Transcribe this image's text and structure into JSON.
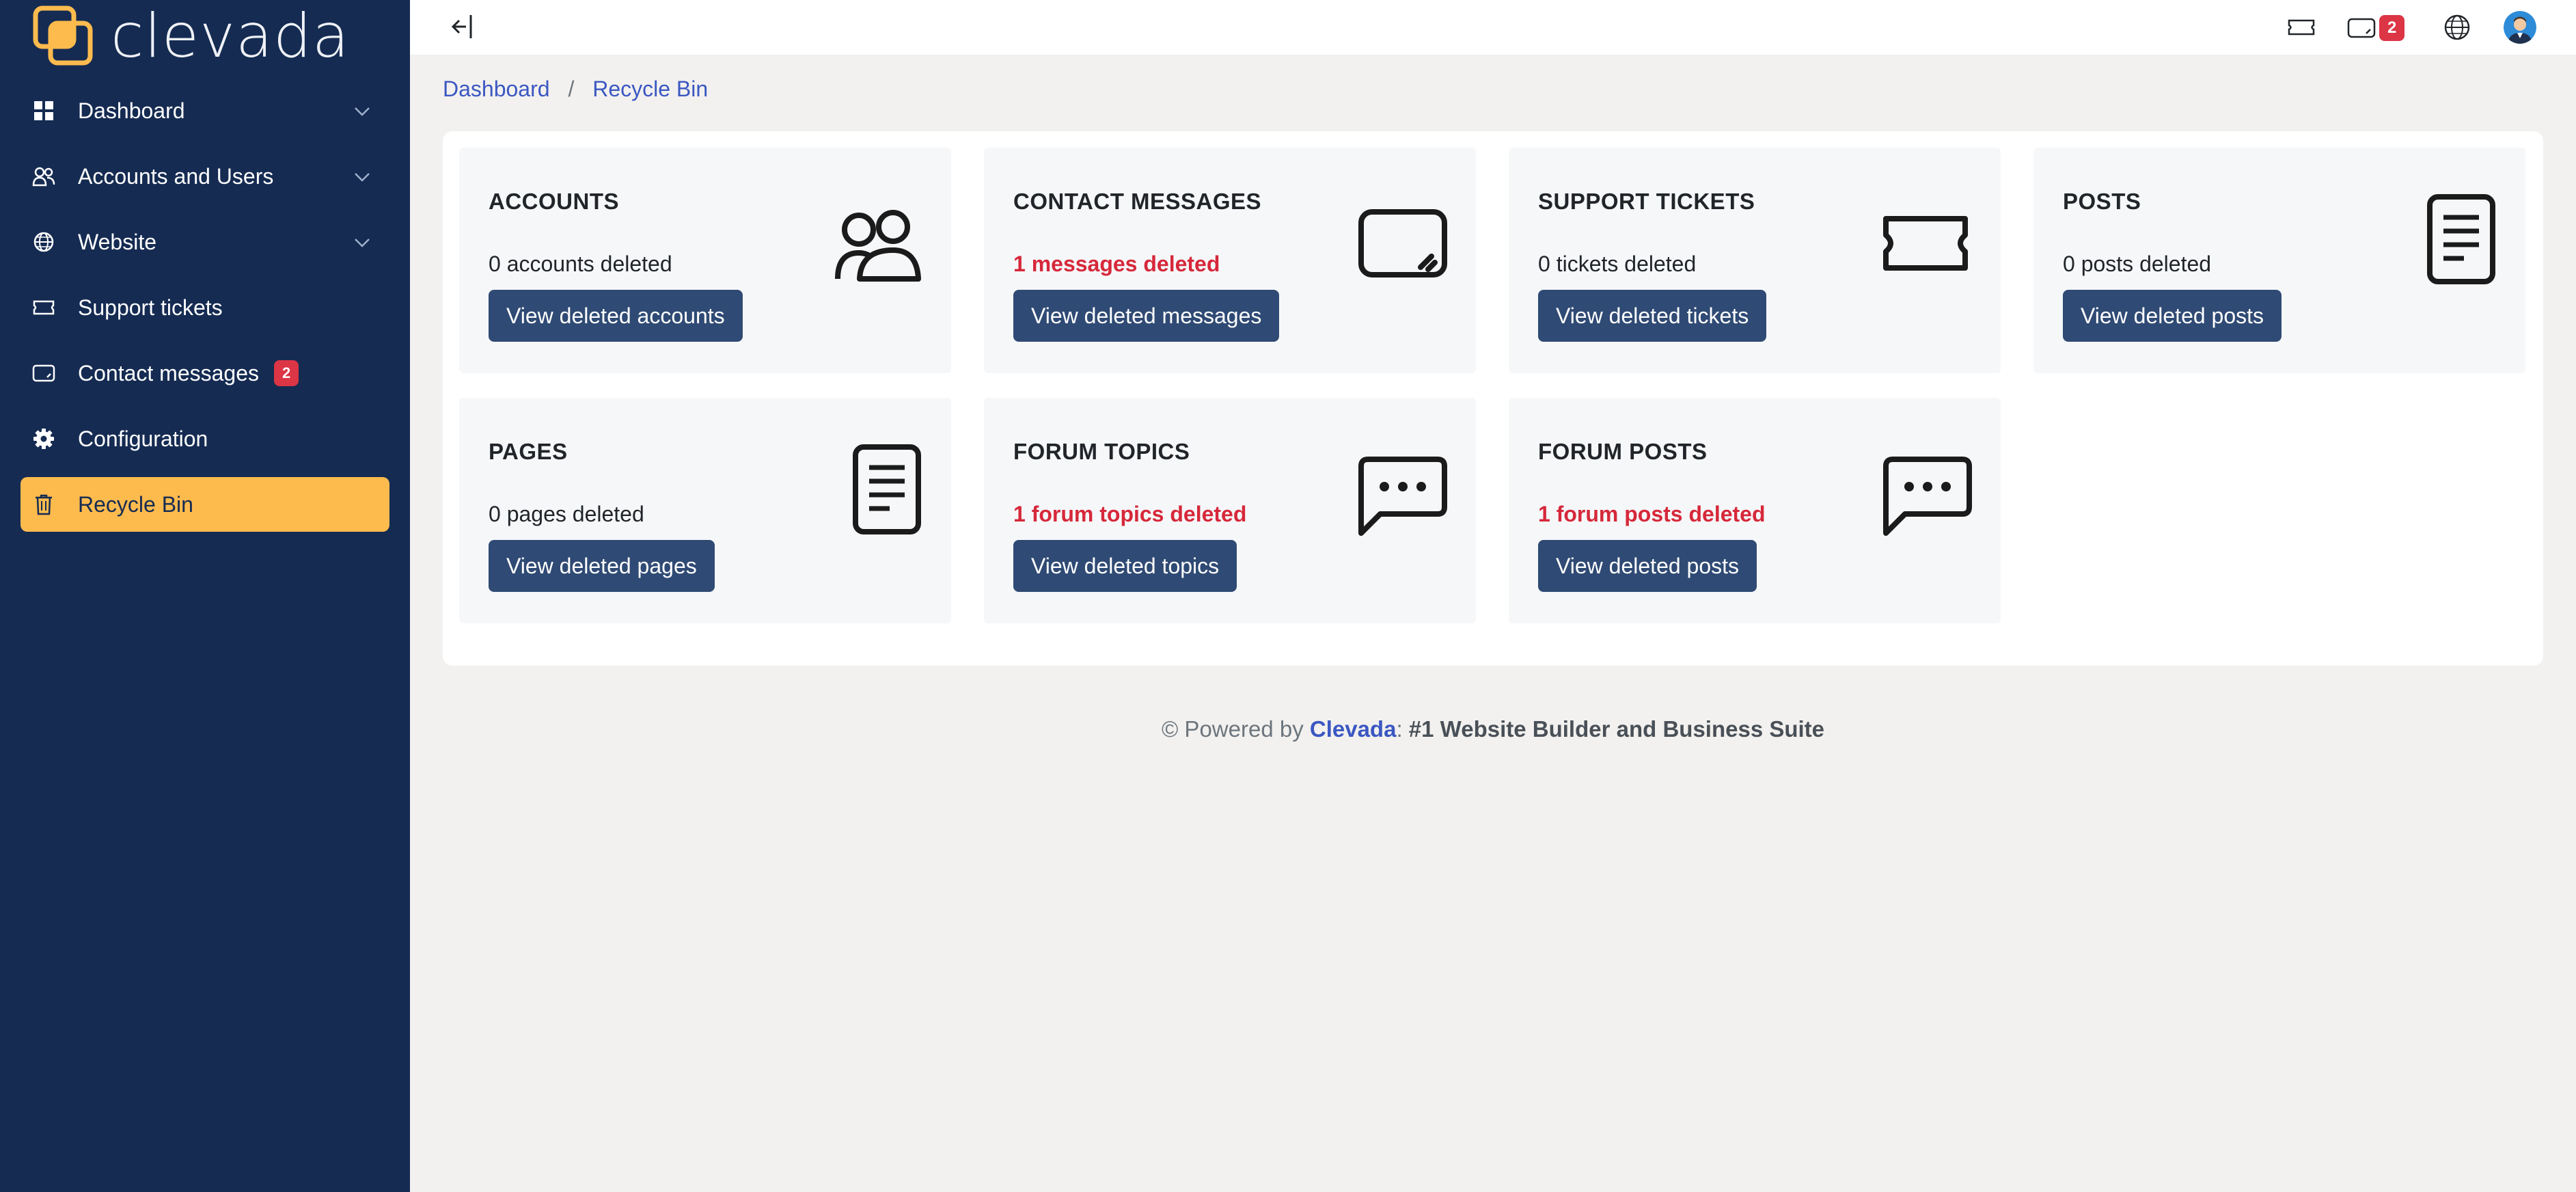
{
  "app": {
    "logo_text": "clevada"
  },
  "colors": {
    "sidebar": "#152b52",
    "accent": "#fdbb4e",
    "primary_button": "#2f4a74",
    "link": "#3b57c2",
    "danger": "#d6283a"
  },
  "sidebar": {
    "items": [
      {
        "label": "Dashboard",
        "icon": "grid-icon",
        "has_dropdown": true,
        "active": false
      },
      {
        "label": "Accounts and Users",
        "icon": "users-icon",
        "has_dropdown": true,
        "active": false
      },
      {
        "label": "Website",
        "icon": "globe-icon",
        "has_dropdown": true,
        "active": false
      },
      {
        "label": "Support tickets",
        "icon": "ticket-icon",
        "has_dropdown": false,
        "active": false
      },
      {
        "label": "Contact messages",
        "icon": "message-box-icon",
        "has_dropdown": false,
        "active": false,
        "badge": "2"
      },
      {
        "label": "Configuration",
        "icon": "gear-icon",
        "has_dropdown": false,
        "active": false
      },
      {
        "label": "Recycle Bin",
        "icon": "trash-icon",
        "has_dropdown": false,
        "active": true
      }
    ]
  },
  "topbar": {
    "messages_badge": "2"
  },
  "breadcrumb": {
    "items": [
      "Dashboard",
      "Recycle Bin"
    ],
    "separator": "/"
  },
  "cards": [
    {
      "title": "ACCOUNTS",
      "count_text": "0 accounts deleted",
      "highlight": false,
      "button": "View deleted accounts",
      "icon": "users-icon"
    },
    {
      "title": "CONTACT MESSAGES",
      "count_text": "1 messages deleted",
      "highlight": true,
      "button": "View deleted messages",
      "icon": "message-box-icon"
    },
    {
      "title": "SUPPORT TICKETS",
      "count_text": "0 tickets deleted",
      "highlight": false,
      "button": "View deleted tickets",
      "icon": "ticket-icon"
    },
    {
      "title": "POSTS",
      "count_text": "0 posts deleted",
      "highlight": false,
      "button": "View deleted posts",
      "icon": "document-icon"
    },
    {
      "title": "PAGES",
      "count_text": "0 pages deleted",
      "highlight": false,
      "button": "View deleted pages",
      "icon": "document-icon"
    },
    {
      "title": "FORUM TOPICS",
      "count_text": "1 forum topics deleted",
      "highlight": true,
      "button": "View deleted topics",
      "icon": "chat-dots-icon"
    },
    {
      "title": "FORUM POSTS",
      "count_text": "1 forum posts deleted",
      "highlight": true,
      "button": "View deleted posts",
      "icon": "chat-dots-icon"
    }
  ],
  "footer": {
    "prefix": "© Powered by ",
    "brand": "Clevada",
    "colon": ": ",
    "tagline": "#1 Website Builder and Business Suite"
  }
}
